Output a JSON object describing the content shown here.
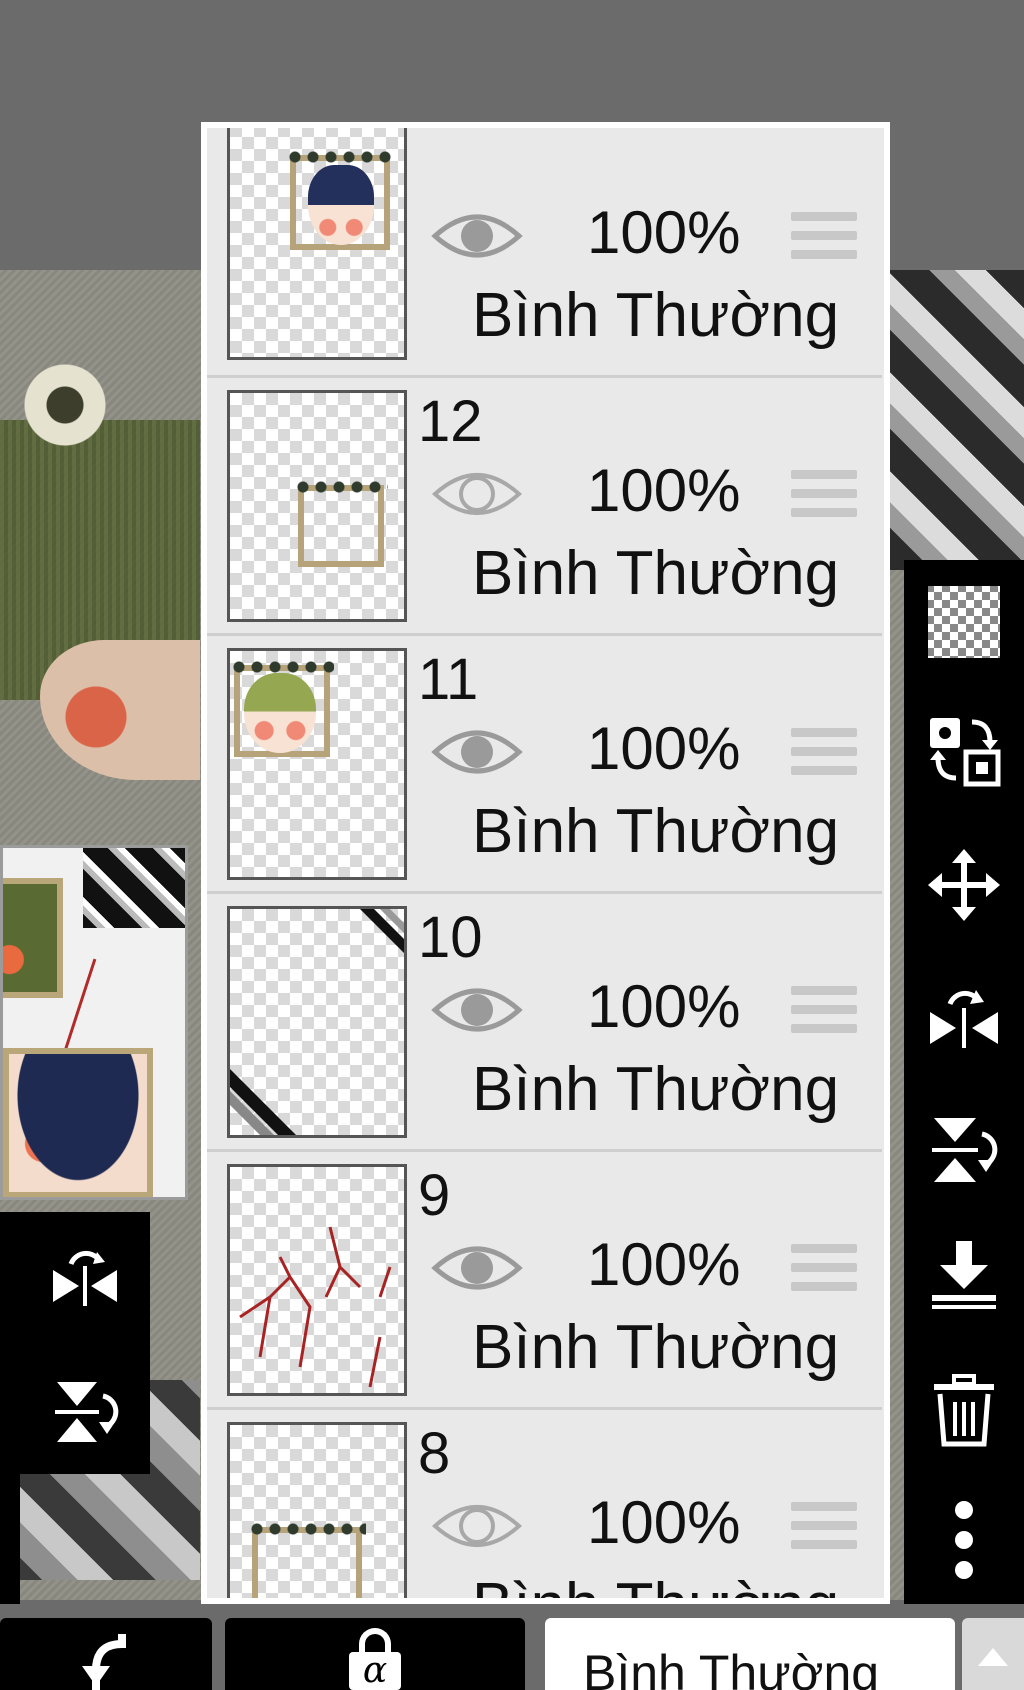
{
  "layers_panel": {
    "layers": [
      {
        "number": "",
        "opacity": "100%",
        "blend_mode": "Bình Thường",
        "visible": true,
        "thumb": "boy-navy-hair"
      },
      {
        "number": "12",
        "opacity": "100%",
        "blend_mode": "Bình Thường",
        "visible": false,
        "thumb": "empty-frame"
      },
      {
        "number": "11",
        "opacity": "100%",
        "blend_mode": "Bình Thường",
        "visible": true,
        "thumb": "green-hair-face"
      },
      {
        "number": "10",
        "opacity": "100%",
        "blend_mode": "Bình Thường",
        "visible": true,
        "thumb": "corner-stripes"
      },
      {
        "number": "9",
        "opacity": "100%",
        "blend_mode": "Bình Thường",
        "visible": true,
        "thumb": "red-branches"
      },
      {
        "number": "8",
        "opacity": "100%",
        "blend_mode": "Bình Thường",
        "visible": false,
        "thumb": "empty-frame"
      }
    ]
  },
  "right_toolbar": {
    "tools": [
      "transparent-layer-icon",
      "swap-layer-icon",
      "move-icon",
      "flip-horizontal-icon",
      "flip-vertical-icon",
      "merge-down-icon",
      "trash-icon",
      "more-vertical-icon"
    ]
  },
  "left_toolbar": {
    "tools": [
      "flip-horizontal-icon",
      "flip-vertical-icon"
    ]
  },
  "bottom_bar": {
    "undo_icon": "undo-arrow-icon",
    "alpha_lock_label": "α",
    "blend_mode_value": "Bình Thường"
  },
  "colors": {
    "background": "#6b6b6b",
    "panel": "#e9e9e9",
    "toolbar": "#000000"
  }
}
